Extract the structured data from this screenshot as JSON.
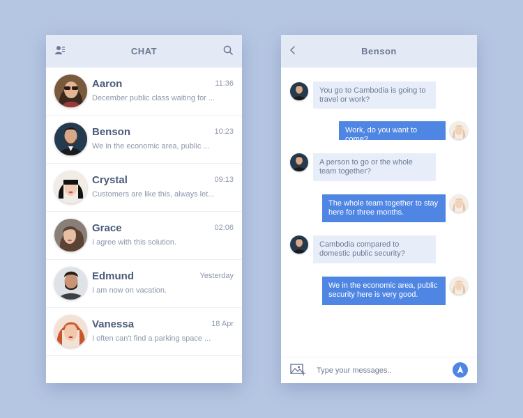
{
  "chat_list": {
    "title": "CHAT",
    "contacts": [
      {
        "name": "Aaron",
        "time": "11:36",
        "preview": "December public class waiting for ..."
      },
      {
        "name": "Benson",
        "time": "10:23",
        "preview": "We in the economic area, public ..."
      },
      {
        "name": "Crystal",
        "time": "09:13",
        "preview": "Customers are like this, always let..."
      },
      {
        "name": "Grace",
        "time": "02:06",
        "preview": "I agree with this solution."
      },
      {
        "name": "Edmund",
        "time": "Yesterday",
        "preview": "I am now on vacation."
      },
      {
        "name": "Vanessa",
        "time": "18 Apr",
        "preview": "I often can't find a parking space ..."
      }
    ]
  },
  "conversation": {
    "title": "Benson",
    "messages": [
      {
        "direction": "in",
        "text": "You go to Cambodia is going to travel or work?"
      },
      {
        "direction": "out",
        "text": "Work, do you want to come?"
      },
      {
        "direction": "in",
        "text": "A person to go or the whole team together?"
      },
      {
        "direction": "out",
        "text": "The whole team together to stay here for three months."
      },
      {
        "direction": "in",
        "text": "Cambodia compared to domestic public security?"
      },
      {
        "direction": "out",
        "text": "We in the economic area, public security here is very good."
      }
    ],
    "composer_placeholder": "Type your messages.."
  },
  "colors": {
    "background": "#b5c6e2",
    "header": "#e4eaf5",
    "accent": "#4f86e3",
    "incoming_bubble": "#e7eefa"
  },
  "icons": {
    "contacts": "contacts-icon",
    "search": "search-icon",
    "back": "chevron-left-icon",
    "image": "add-image-icon",
    "send": "send-icon"
  }
}
